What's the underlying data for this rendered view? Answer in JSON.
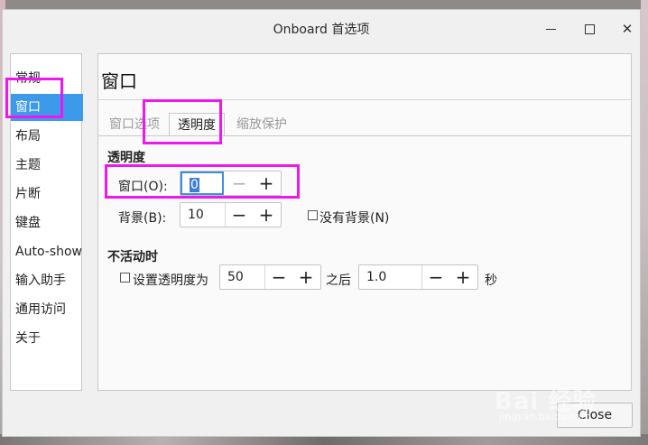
{
  "window": {
    "title": "Onboard 首选项"
  },
  "sidebar": {
    "items": [
      {
        "label": "常规"
      },
      {
        "label": "窗口"
      },
      {
        "label": "布局"
      },
      {
        "label": "主题"
      },
      {
        "label": "片断"
      },
      {
        "label": "键盘"
      },
      {
        "label": "Auto-show"
      },
      {
        "label": "输入助手"
      },
      {
        "label": "通用访问"
      },
      {
        "label": "关于"
      }
    ],
    "selected": "窗口"
  },
  "main": {
    "title": "窗口",
    "tabs": [
      {
        "label": "窗口选项"
      },
      {
        "label": "透明度"
      },
      {
        "label": "缩放保护"
      }
    ],
    "active_tab": "透明度",
    "transparency": {
      "heading": "透明度",
      "window_label": "窗口(O):",
      "window_value": "0",
      "background_label": "背景(B):",
      "background_value": "10",
      "no_background_label": "没有背景(N)"
    },
    "inactive": {
      "heading": "不活动时",
      "set_label": "设置透明度为",
      "opacity_value": "50",
      "after_label": "之后",
      "delay_value": "1.0",
      "unit_label": "秒"
    }
  },
  "footer": {
    "close_label": "Close"
  },
  "watermark": {
    "text": "Bai 经验",
    "url": "jingyan.baidu.com"
  },
  "colors": {
    "selection": "#3d9aea",
    "highlight": "#ee18ee"
  },
  "icons": {
    "minus": "minus-icon",
    "plus": "plus-icon"
  }
}
